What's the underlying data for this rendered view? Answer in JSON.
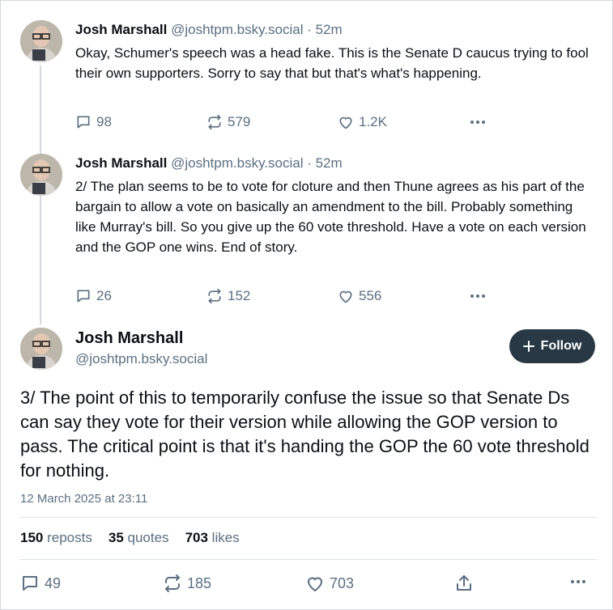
{
  "posts": [
    {
      "author": "Josh Marshall",
      "handle": "@joshtpm.bsky.social · 52m",
      "text": "Okay, Schumer's speech was a head fake. This is the Senate D caucus trying to fool their own supporters. Sorry to say that but that's what's happening.",
      "replies": "98",
      "reposts": "579",
      "likes": "1.2K"
    },
    {
      "author": "Josh Marshall",
      "handle": "@joshtpm.bsky.social · 52m",
      "text": "2/ The plan seems to be to vote for cloture and then Thune agrees as his part of the bargain to allow a vote on basically an amendment to the bill. Probably something like Murray's bill. So you give up the 60 vote threshold. Have a vote on each version and the GOP one wins. End of story.",
      "replies": "26",
      "reposts": "152",
      "likes": "556"
    }
  ],
  "main": {
    "author": "Josh Marshall",
    "handle": "@joshtpm.bsky.social",
    "follow_label": "Follow",
    "text": "3/ The point of this to temporarily confuse the issue so that Senate Ds can say they vote for their version while allowing the GOP version to pass. The critical point is that it's handing the GOP the 60 vote threshold for nothing.",
    "date": "12 March 2025 at 23:11",
    "stats": {
      "reposts_count": "150",
      "reposts_label": "reposts",
      "quotes_count": "35",
      "quotes_label": "quotes",
      "likes_count": "703",
      "likes_label": "likes"
    },
    "replies": "49",
    "reposts": "185",
    "likes": "703"
  },
  "icons": {
    "reply": "speech-bubble-icon",
    "repost": "repost-arrows-icon",
    "like": "heart-icon",
    "more": "ellipsis-icon",
    "share": "share-icon",
    "follow": "plus-icon"
  },
  "colors": {
    "muted": "#5b6f82",
    "follow_bg": "#283845",
    "border": "#d4d9de"
  }
}
